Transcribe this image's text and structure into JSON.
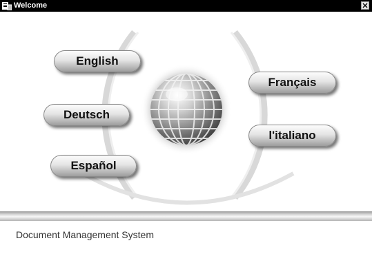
{
  "window": {
    "title": "Welcome",
    "close_glyph": "✕"
  },
  "languages": {
    "english": "English",
    "deutsch": "Deutsch",
    "espanol": "Español",
    "francais": "Français",
    "italiano": "l'italiano"
  },
  "footer": {
    "text": "Document Management System"
  },
  "icons": {
    "app": "app-icon",
    "globe": "globe-icon",
    "close": "close-icon"
  },
  "colors": {
    "titlebar": "#000000",
    "button_light": "#fcfcfc",
    "button_dark": "#9e9e9e",
    "background": "#ffffff"
  }
}
